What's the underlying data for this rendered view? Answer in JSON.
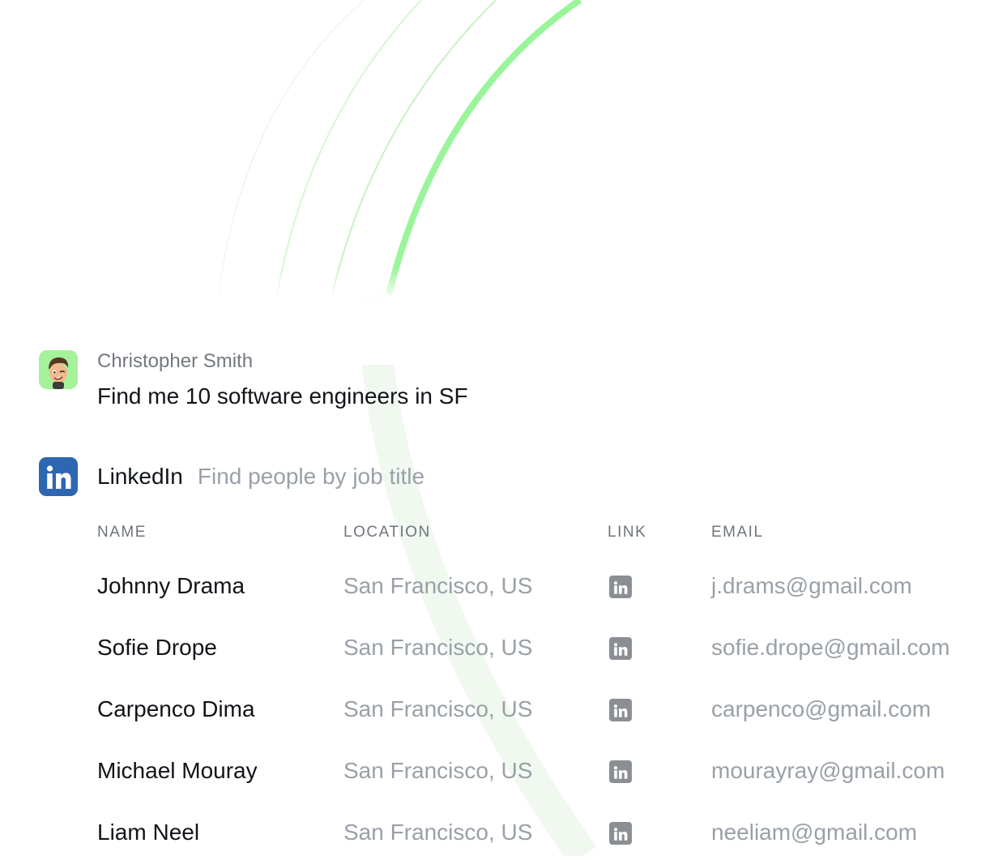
{
  "message": {
    "author": "Christopher Smith",
    "text": "Find me 10 software engineers in SF",
    "avatar_icon": "memoji-avatar",
    "avatar_bg": "#a6f29a"
  },
  "tool": {
    "name": "LinkedIn",
    "description": "Find people by job title",
    "icon": "linkedin-icon",
    "brand_color": "#2d67b2"
  },
  "table": {
    "headers": {
      "name": "NAME",
      "location": "LOCATION",
      "link": "LINK",
      "email": "EMAIL"
    },
    "rows": [
      {
        "name": "Johnny Drama",
        "location": "San Francisco, US",
        "link_icon": "linkedin-icon",
        "email": "j.drams@gmail.com"
      },
      {
        "name": "Sofie Drope",
        "location": "San Francisco, US",
        "link_icon": "linkedin-icon",
        "email": "sofie.drope@gmail.com"
      },
      {
        "name": "Carpenco Dima",
        "location": "San Francisco, US",
        "link_icon": "linkedin-icon",
        "email": "carpenco@gmail.com"
      },
      {
        "name": "Michael Mouray",
        "location": "San Francisco, US",
        "link_icon": "linkedin-icon",
        "email": "mourayray@gmail.com"
      },
      {
        "name": "Liam Neel",
        "location": "San Francisco, US",
        "link_icon": "linkedin-icon",
        "email": "neeliam@gmail.com"
      }
    ]
  },
  "colors": {
    "accent_arc": "#9af59a"
  }
}
